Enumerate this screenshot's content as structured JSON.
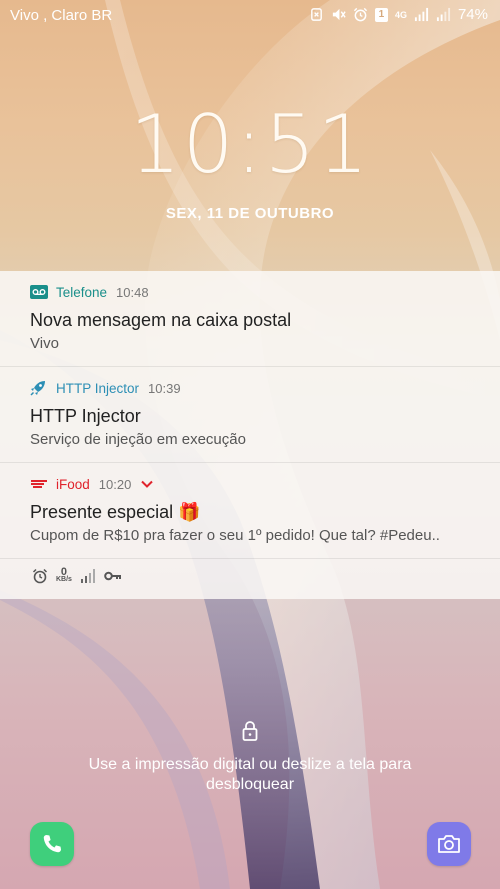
{
  "statusbar": {
    "carrier": "Vivo , Claro BR",
    "network": "4G",
    "sim_badge": "1",
    "battery": "74%"
  },
  "clock": {
    "time": "10:51",
    "date": "SEX, 11 DE OUTUBRO"
  },
  "notifications": [
    {
      "app": "Telefone",
      "time": "10:48",
      "title": "Nova mensagem na caixa postal",
      "text": "Vivo",
      "accent": "#1a8f8a",
      "icon": "voicemail-icon"
    },
    {
      "app": "HTTP Injector",
      "time": "10:39",
      "title": "HTTP Injector",
      "text": "Serviço de injeção em execução",
      "accent": "#2d8fb5",
      "icon": "rocket-icon"
    },
    {
      "app": "iFood",
      "time": "10:20",
      "title": "Presente especial 🎁",
      "text": "Cupom de R$10 pra fazer o seu 1º pedido! Que tal? #Pedeu..",
      "accent": "#e0232c",
      "icon": "ifood-logo-icon"
    }
  ],
  "notification_status_row": {
    "speed_value": "0",
    "speed_unit": "KB/s"
  },
  "unlock_hint": "Use a impressão digital ou deslize a tela para desbloquear",
  "colors": {
    "phone_button": "#3fcf7c",
    "camera_button": "#7f7ae8"
  }
}
